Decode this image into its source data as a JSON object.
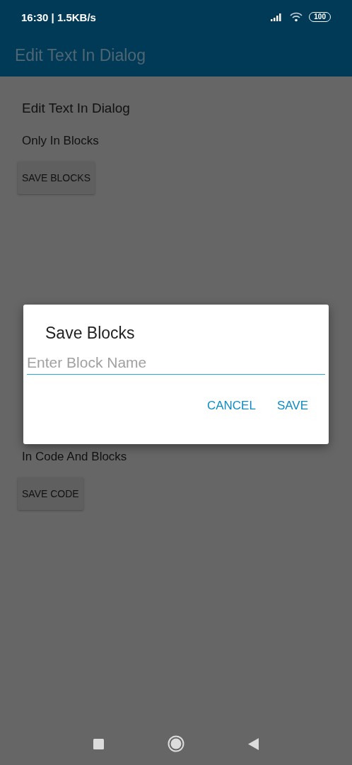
{
  "status_bar": {
    "time": "16:30 | 1.5KB/s",
    "battery": "100"
  },
  "app_bar": {
    "title": "Edit Text In Dialog"
  },
  "sections": [
    {
      "heading": "Edit Text In Dialog",
      "caption": "Only In Blocks",
      "button": "SAVE BLOCKS"
    },
    {
      "caption": "In Code And Blocks",
      "button": "SAVE CODE"
    }
  ],
  "dialog": {
    "title": "Save Blocks",
    "field": {
      "placeholder": "Enter Block Name"
    },
    "buttons": [
      "CANCEL",
      "SAVE"
    ]
  }
}
